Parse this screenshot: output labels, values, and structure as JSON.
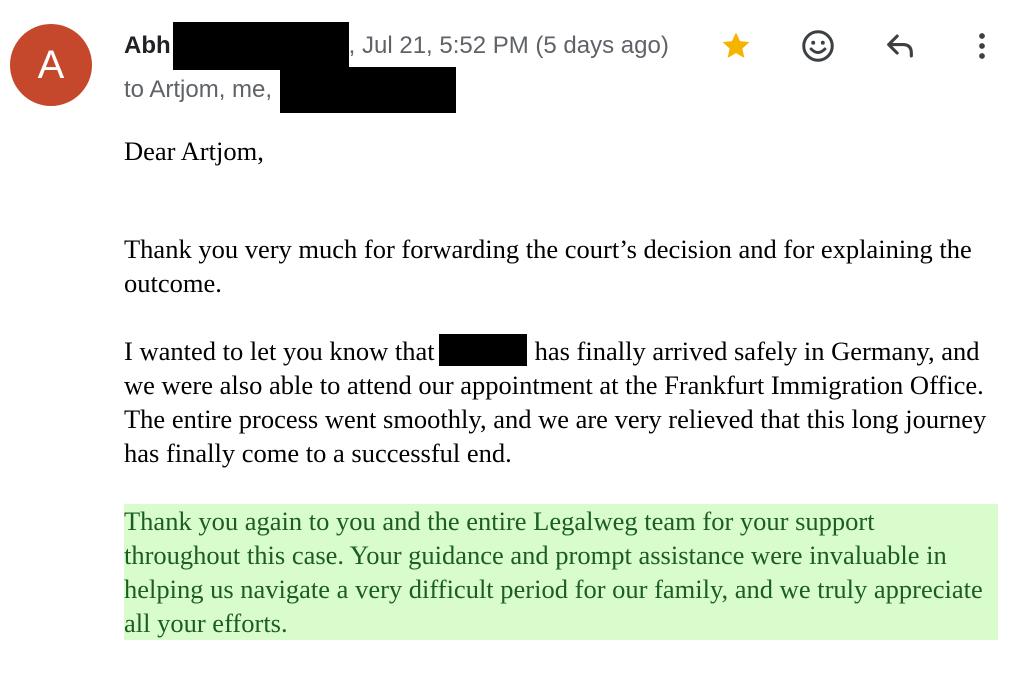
{
  "sender": {
    "avatar_letter": "A",
    "avatar_color": "#c5472c",
    "name_visible": "Abh",
    "date_text": ", Jul 21, 5:52 PM (5 days ago)"
  },
  "recipients": {
    "text": "to Artjom, me,"
  },
  "actions": {
    "star_icon": "star-icon",
    "star_color": "#f4b400",
    "emoji_icon": "add-reaction-icon",
    "reply_icon": "reply-icon",
    "more_icon": "more-vertical-icon"
  },
  "message": {
    "greeting": "Dear Artjom,",
    "paragraph1": "Thank you very much for forwarding the court’s decision and for explaining the outcome.",
    "paragraph2_before": "I wanted to let you know that",
    "paragraph2_after": "has finally arrived safely in Germany, and we were also able to attend our appointment at the Frankfurt Immigration Office. The entire process went smoothly, and we are very relieved that this long journey has finally come to a successful end.",
    "paragraph3": "Thank you again to you and the entire Legalweg team for your support throughout this case. Your guidance and prompt assistance were invaluable in helping us navigate a very difficult period for our family, and we truly appreciate all your efforts.",
    "highlight_color": "#d9fccd"
  }
}
